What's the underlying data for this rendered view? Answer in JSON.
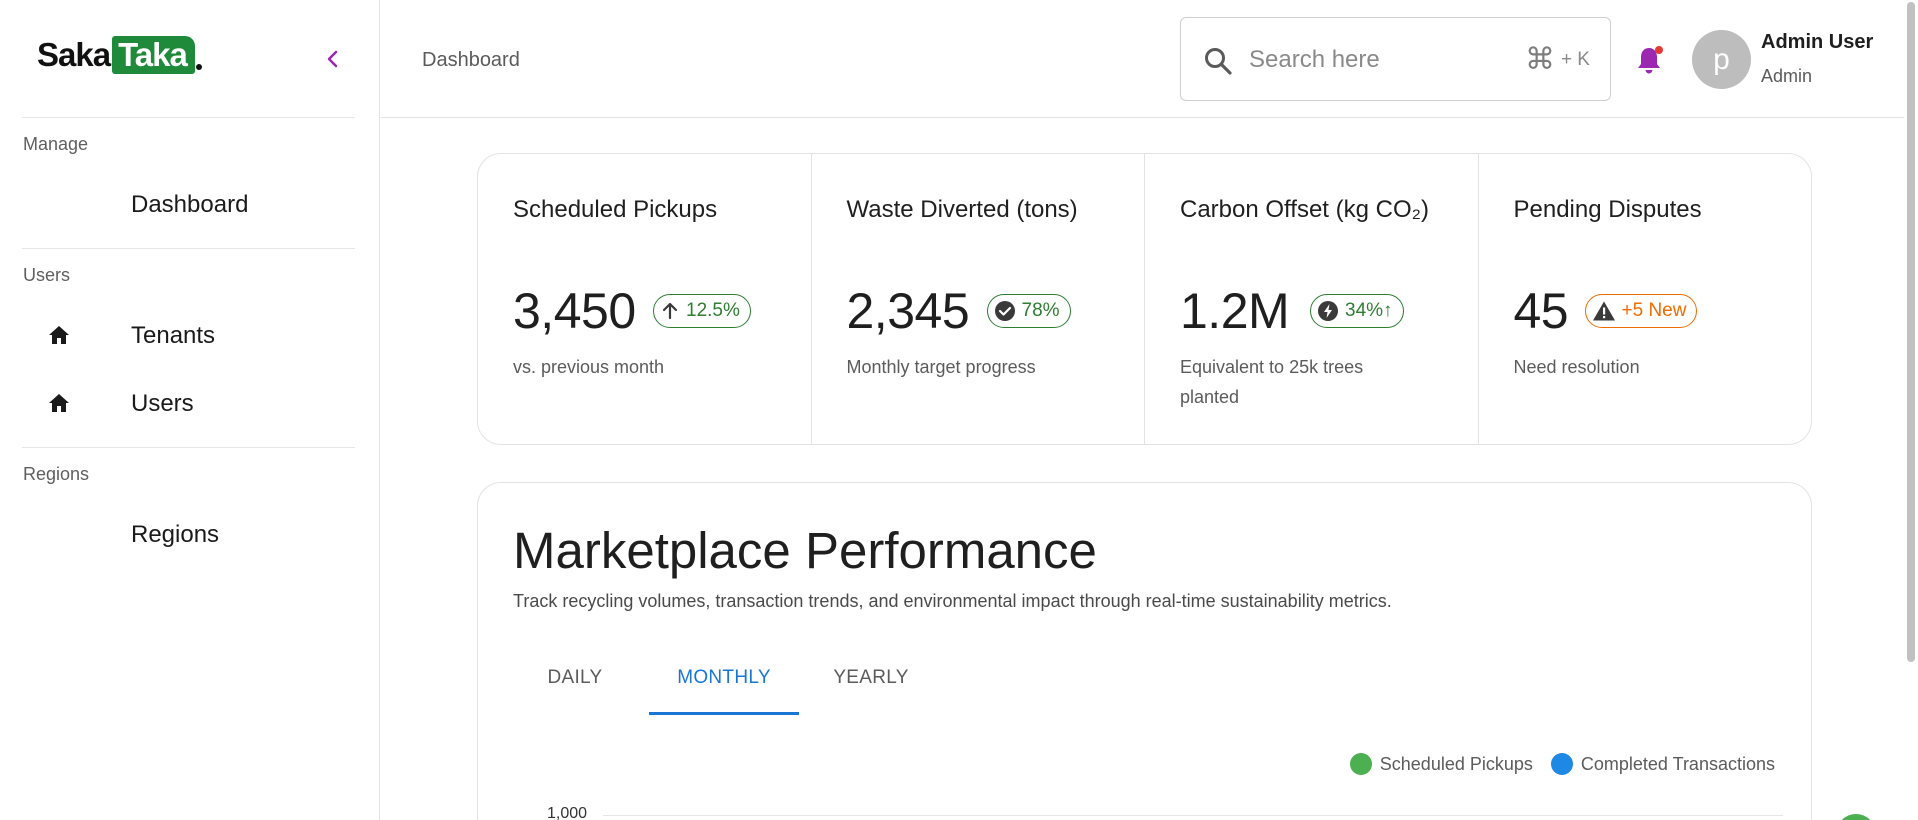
{
  "brand": {
    "part1": "Saka",
    "part2": "Taka",
    "accent": "#1e8a3a"
  },
  "sidebar": {
    "collapse_icon": "chevron-left-icon",
    "sections": [
      {
        "label": "Manage",
        "items": [
          {
            "label": "Dashboard",
            "icon": ""
          }
        ]
      },
      {
        "label": "Users",
        "items": [
          {
            "label": "Tenants",
            "icon": "home-icon"
          },
          {
            "label": "Users",
            "icon": "home-icon"
          }
        ]
      },
      {
        "label": "Regions",
        "items": [
          {
            "label": "Regions",
            "icon": ""
          }
        ]
      }
    ]
  },
  "header": {
    "breadcrumb": "Dashboard",
    "search": {
      "placeholder": "Search here",
      "shortcut_symbol": "⌘",
      "shortcut_key": "+ K"
    },
    "notification_icon": "bell-icon",
    "user": {
      "avatar_letter": "p",
      "name": "Admin User",
      "role": "Admin"
    }
  },
  "stats": [
    {
      "title": "Scheduled Pickups",
      "value": "3,450",
      "badge": "12.5%",
      "badge_icon": "arrow-up-icon",
      "note": "vs. previous month",
      "color": "#2e7d32"
    },
    {
      "title": "Waste Diverted (tons)",
      "value": "2,345",
      "badge": "78%",
      "badge_icon": "check-circle-icon",
      "note": "Monthly target progress",
      "color": "#2e7d32"
    },
    {
      "title": "Carbon Offset (kg CO₂)",
      "value": "1.2M",
      "badge": "34%↑",
      "badge_icon": "eco-bolt-icon",
      "note": "Equivalent to 25k trees planted",
      "color": "#2e7d32"
    },
    {
      "title": "Pending Disputes",
      "value": "45",
      "badge": "+5 New",
      "badge_icon": "warning-icon",
      "note": "Need resolution",
      "color": "#ef6c00"
    }
  ],
  "performance": {
    "title": "Marketplace Performance",
    "subtitle": "Track recycling volumes, transaction trends, and environmental impact through real-time sustainability metrics.",
    "tabs": [
      "DAILY",
      "MONTHLY",
      "YEARLY"
    ],
    "active_tab": "MONTHLY",
    "legend": [
      {
        "label": "Scheduled Pickups",
        "color": "#4caf50"
      },
      {
        "label": "Completed Transactions",
        "color": "#1e88e5"
      }
    ],
    "y_tick_top": "1,000"
  }
}
